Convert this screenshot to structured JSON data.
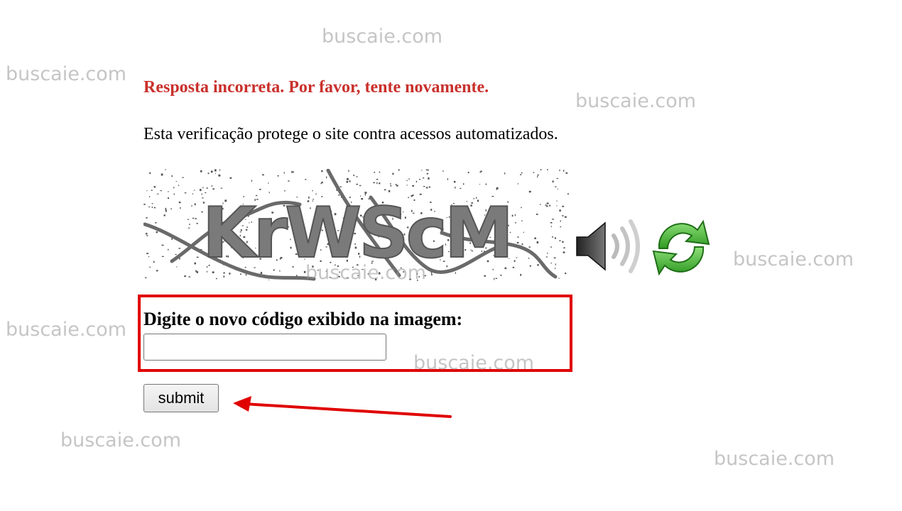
{
  "form": {
    "error_message": "Resposta incorreta. Por favor, tente novamente.",
    "info_text": "Esta verificação protege o site contra acessos automatizados.",
    "captcha": {
      "code_text": "KrWScM",
      "audio_icon": "speaker-icon",
      "refresh_icon": "refresh-icon"
    },
    "field_label": "Digite o novo código exibido na imagem:",
    "code_input_value": "",
    "submit_label": "submit"
  },
  "annotation": {
    "highlight_color": "#e00000",
    "arrow_color": "#e00000"
  },
  "colors": {
    "error": "#c9302c",
    "refresh_green": "#3aa52a"
  },
  "watermarks": [
    "buscaie.com",
    "buscaie.com",
    "buscaie.com",
    "buscaie.com",
    "buscaie.com",
    "buscaie.com",
    "buscaie.com",
    "buscaie.com",
    "buscaie.com"
  ]
}
